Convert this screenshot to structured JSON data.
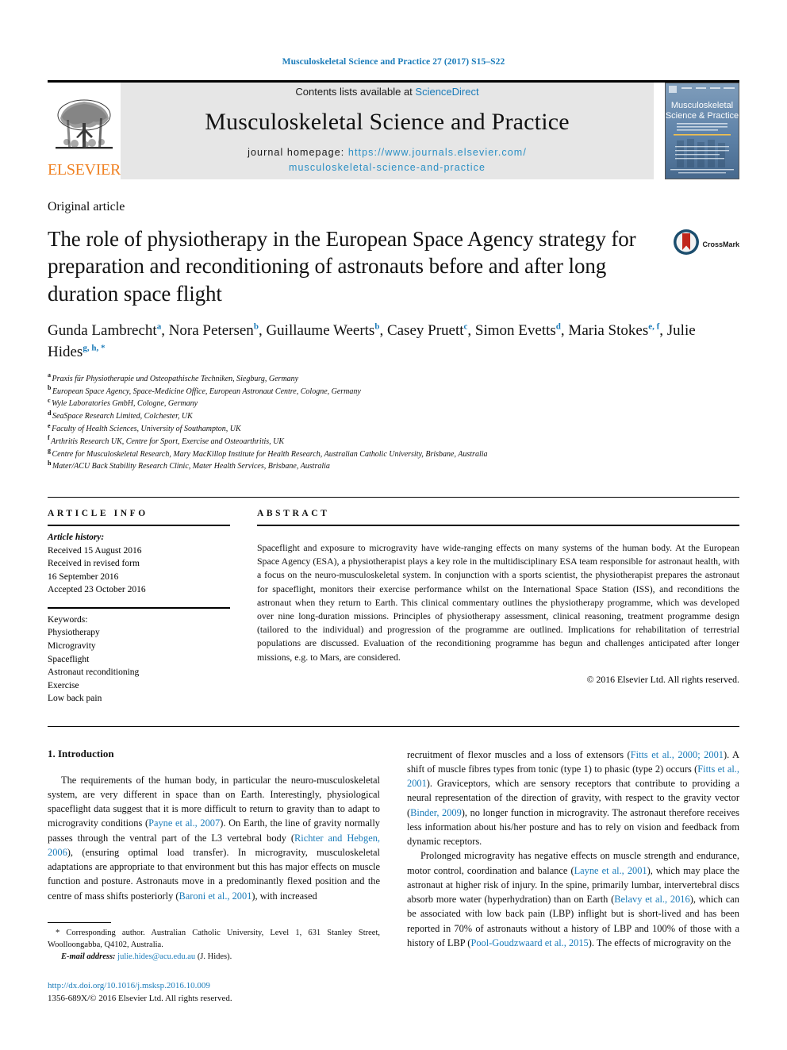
{
  "running_head": "Musculoskeletal Science and Practice 27 (2017) S15–S22",
  "masthead": {
    "elsevier_wordmark": "ELSEVIER",
    "contents_prefix": "Contents lists available at ",
    "contents_link": "ScienceDirect",
    "journal_title": "Musculoskeletal Science and Practice",
    "homepage_label": "journal homepage:",
    "homepage_url_line1": "https://www.journals.elsevier.com/",
    "homepage_url_line2": "musculoskeletal-science-and-practice",
    "cover_title_line1": "Musculoskeletal",
    "cover_title_line2": "Science & Practice"
  },
  "article": {
    "type": "Original article",
    "title": "The role of physiotherapy in the European Space Agency strategy for preparation and reconditioning of astronauts before and after long duration space flight",
    "crossmark_label": "CrossMark",
    "authors": [
      {
        "name": "Gunda Lambrecht",
        "marks": "a",
        "sep": ", "
      },
      {
        "name": "Nora Petersen",
        "marks": "b",
        "sep": ", "
      },
      {
        "name": "Guillaume Weerts",
        "marks": "b",
        "sep": ", "
      },
      {
        "name": "Casey Pruett",
        "marks": "c",
        "sep": ", "
      },
      {
        "name": "Simon Evetts",
        "marks": "d",
        "sep": ", "
      },
      {
        "name": "Maria Stokes",
        "marks": "e, f",
        "sep": ", "
      },
      {
        "name": "Julie Hides",
        "marks": "g, h, *",
        "sep": ""
      }
    ],
    "affiliations": [
      {
        "label": "a",
        "text": "Praxis für Physiotherapie und Osteopathische Techniken, Siegburg, Germany"
      },
      {
        "label": "b",
        "text": "European Space Agency, Space-Medicine Office, European Astronaut Centre, Cologne, Germany"
      },
      {
        "label": "c",
        "text": "Wyle Laboratories GmbH, Cologne, Germany"
      },
      {
        "label": "d",
        "text": "SeaSpace Research Limited, Colchester, UK"
      },
      {
        "label": "e",
        "text": "Faculty of Health Sciences, University of Southampton, UK"
      },
      {
        "label": "f",
        "text": "Arthritis Research UK, Centre for Sport, Exercise and Osteoarthritis, UK"
      },
      {
        "label": "g",
        "text": "Centre for Musculoskeletal Research, Mary MacKillop Institute for Health Research, Australian Catholic University, Brisbane, Australia"
      },
      {
        "label": "h",
        "text": "Mater/ACU Back Stability Research Clinic, Mater Health Services, Brisbane, Australia"
      }
    ]
  },
  "article_info": {
    "heading": "ARTICLE INFO",
    "history_label": "Article history:",
    "history_lines": [
      "Received 15 August 2016",
      "Received in revised form",
      "16 September 2016",
      "Accepted 23 October 2016"
    ],
    "keywords_label": "Keywords:",
    "keywords": [
      "Physiotherapy",
      "Microgravity",
      "Spaceflight",
      "Astronaut reconditioning",
      "Exercise",
      "Low back pain"
    ]
  },
  "abstract": {
    "heading": "ABSTRACT",
    "text": "Spaceflight and exposure to microgravity have wide-ranging effects on many systems of the human body. At the European Space Agency (ESA), a physiotherapist plays a key role in the multidisciplinary ESA team responsible for astronaut health, with a focus on the neuro-musculoskeletal system. In conjunction with a sports scientist, the physiotherapist prepares the astronaut for spaceflight, monitors their exercise performance whilst on the International Space Station (ISS), and reconditions the astronaut when they return to Earth. This clinical commentary outlines the physiotherapy programme, which was developed over nine long-duration missions. Principles of physiotherapy assessment, clinical reasoning, treatment programme design (tailored to the individual) and progression of the programme are outlined. Implications for rehabilitation of terrestrial populations are discussed. Evaluation of the reconditioning programme has begun and challenges anticipated after longer missions, e.g. to Mars, are considered.",
    "copyright": "© 2016 Elsevier Ltd. All rights reserved."
  },
  "body": {
    "section_number_title": "1. Introduction",
    "left_paragraph_1_parts": [
      {
        "t": "The requirements of the human body, in particular the neuro-musculoskeletal system, are very different in space than on Earth. Interestingly, physiological spaceflight data suggest that it is more difficult to return to gravity than to adapt to microgravity conditions (",
        "ref": false
      },
      {
        "t": "Payne et al., 2007",
        "ref": true
      },
      {
        "t": "). On Earth, the line of gravity normally passes through the ventral part of the L3 vertebral body (",
        "ref": false
      },
      {
        "t": "Richter and Hebgen, 2006",
        "ref": true
      },
      {
        "t": "), (ensuring optimal load transfer). In microgravity, musculoskeletal adaptations are appropriate to that environment but this has major effects on muscle function and posture. Astronauts move in a predominantly flexed position and the centre of mass shifts posteriorly (",
        "ref": false
      },
      {
        "t": "Baroni et al., 2001",
        "ref": true
      },
      {
        "t": "), with increased",
        "ref": false
      }
    ],
    "right_paragraph_1_parts": [
      {
        "t": "recruitment of flexor muscles and a loss of extensors (",
        "ref": false
      },
      {
        "t": "Fitts et al., 2000; 2001",
        "ref": true
      },
      {
        "t": "). A shift of muscle fibres types from tonic (type 1) to phasic (type 2) occurs (",
        "ref": false
      },
      {
        "t": "Fitts et al., 2001",
        "ref": true
      },
      {
        "t": "). Graviceptors, which are sensory receptors that contribute to providing a neural representation of the direction of gravity, with respect to the gravity vector (",
        "ref": false
      },
      {
        "t": "Binder, 2009",
        "ref": true
      },
      {
        "t": "), no longer function in microgravity. The astronaut therefore receives less information about his/her posture and has to rely on vision and feedback from dynamic receptors.",
        "ref": false
      }
    ],
    "right_paragraph_2_parts": [
      {
        "t": "Prolonged microgravity has negative effects on muscle strength and endurance, motor control, coordination and balance (",
        "ref": false
      },
      {
        "t": "Layne et al., 2001",
        "ref": true
      },
      {
        "t": "), which may place the astronaut at higher risk of injury. In the spine, primarily lumbar, intervertebral discs absorb more water (hyperhydration) than on Earth (",
        "ref": false
      },
      {
        "t": "Belavy et al., 2016",
        "ref": true
      },
      {
        "t": "), which can be associated with low back pain (LBP) inflight but is short-lived and has been reported in 70% of astronauts without a history of LBP and 100% of those with a history of LBP (",
        "ref": false
      },
      {
        "t": "Pool-Goudzwaard et al., 2015",
        "ref": true
      },
      {
        "t": "). The effects of microgravity on the",
        "ref": false
      }
    ]
  },
  "footnote": {
    "corresponding_marker": "*",
    "corresponding_text": " Corresponding author. Australian Catholic University, Level 1, 631 Stanley Street, Woolloongabba, Q4102, Australia.",
    "email_label": "E-mail address:",
    "email": "julie.hides@acu.edu.au",
    "email_owner": "(J. Hides).",
    "doi": "http://dx.doi.org/10.1016/j.msksp.2016.10.009",
    "issn_line": "1356-689X/© 2016 Elsevier Ltd. All rights reserved."
  },
  "colors": {
    "link_blue": "#1a7bb9",
    "elsevier_orange": "#f08224",
    "masthead_grey": "#e6e6e6",
    "crossmark_red": "#c0271c",
    "crossmark_blue": "#1c4e6e"
  }
}
